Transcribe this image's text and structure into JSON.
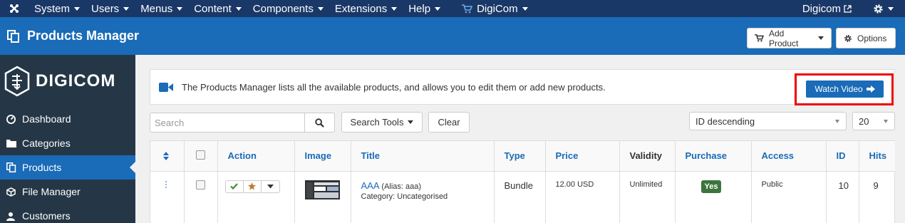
{
  "topbar": {
    "menus": [
      "System",
      "Users",
      "Menus",
      "Content",
      "Components",
      "Extensions",
      "Help"
    ],
    "digicom_menu": "DigiCom",
    "site_link": "Digicom"
  },
  "subhead": {
    "title": "Products Manager",
    "add_product": "Add Product",
    "options": "Options"
  },
  "sidebar": {
    "logo": "DIGICOM",
    "items": [
      {
        "label": "Dashboard",
        "icon": "dashboard-icon"
      },
      {
        "label": "Categories",
        "icon": "folder-icon"
      },
      {
        "label": "Products",
        "icon": "products-icon",
        "active": true
      },
      {
        "label": "File Manager",
        "icon": "cube-icon"
      },
      {
        "label": "Customers",
        "icon": "users-icon"
      }
    ]
  },
  "info": {
    "message": "The Products Manager lists all the available products, and allows you to edit them or add new products.",
    "watch_video": "Watch Video"
  },
  "filters": {
    "search_placeholder": "Search",
    "search_tools": "Search Tools",
    "clear": "Clear",
    "ordering": "ID descending",
    "limit": "20"
  },
  "table": {
    "headers": [
      "Action",
      "Image",
      "Title",
      "Type",
      "Price",
      "Validity",
      "Purchase",
      "Access",
      "ID",
      "Hits"
    ],
    "rows": [
      {
        "title": "AAA",
        "alias": "(Alias: aaa)",
        "category": "Category: Uncategorised",
        "type": "Bundle",
        "price": "12.00 USD",
        "validity": "Unlimited",
        "purchase": "Yes",
        "access": "Public",
        "id": "10",
        "hits": "9"
      }
    ]
  },
  "colors": {
    "navbar": "#1a3867",
    "header": "#1a6bb8",
    "sidebar": "#253746",
    "highlight_border": "#e00000",
    "yes_badge": "#3c763d"
  }
}
